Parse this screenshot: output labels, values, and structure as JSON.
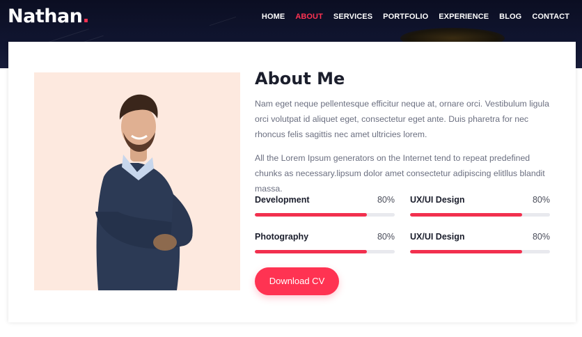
{
  "brand": {
    "name": "Nathan",
    "dot": ".",
    "accent_color": "#ff3352"
  },
  "nav": {
    "items": [
      {
        "label": "HOME",
        "active": false
      },
      {
        "label": "ABOUT",
        "active": true
      },
      {
        "label": "SERVICES",
        "active": false
      },
      {
        "label": "PORTFOLIO",
        "active": false
      },
      {
        "label": "EXPERIENCE",
        "active": false
      },
      {
        "label": "BLOG",
        "active": false
      },
      {
        "label": "CONTACT",
        "active": false
      }
    ]
  },
  "about": {
    "title": "About Me",
    "paragraph_1": "Nam eget neque pellentesque efficitur neque at, ornare orci. Vestibulum ligula orci volutpat id aliquet eget, consectetur eget ante. Duis pharetra for nec rhoncus felis sagittis nec amet ultricies lorem.",
    "paragraph_2": "All the Lorem Ipsum generators on the Internet tend to repeat predefined chunks as necessary.lipsum dolor amet consectetur adipiscing elitllus blandit massa.",
    "photo": {
      "icon": "person-portrait",
      "background": "#fde9df"
    },
    "skills": [
      {
        "name": "Development",
        "percent_label": "80%",
        "level": 0.8
      },
      {
        "name": "UX/UI Design",
        "percent_label": "80%",
        "level": 0.8
      },
      {
        "name": "Photography",
        "percent_label": "80%",
        "level": 0.8
      },
      {
        "name": "UX/UI Design",
        "percent_label": "80%",
        "level": 0.8
      }
    ],
    "download_label": "Download CV"
  },
  "colors": {
    "progress_fill": "#f2304e",
    "progress_track": "#e8e9ee",
    "header_bg": "#0b0e22"
  }
}
